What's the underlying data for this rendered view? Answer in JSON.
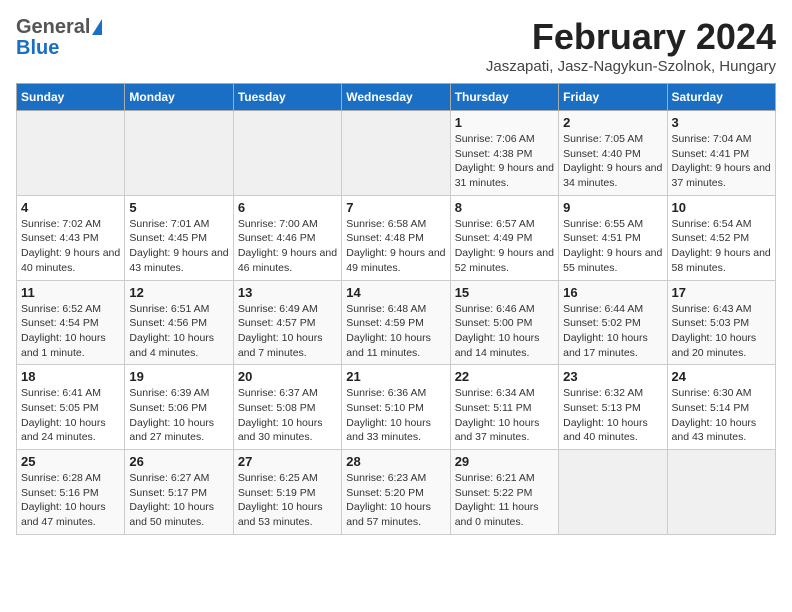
{
  "header": {
    "logo_general": "General",
    "logo_blue": "Blue",
    "month_title": "February 2024",
    "location": "Jaszapati, Jasz-Nagykun-Szolnok, Hungary"
  },
  "weekdays": [
    "Sunday",
    "Monday",
    "Tuesday",
    "Wednesday",
    "Thursday",
    "Friday",
    "Saturday"
  ],
  "weeks": [
    [
      {
        "day": "",
        "info": ""
      },
      {
        "day": "",
        "info": ""
      },
      {
        "day": "",
        "info": ""
      },
      {
        "day": "",
        "info": ""
      },
      {
        "day": "1",
        "info": "Sunrise: 7:06 AM\nSunset: 4:38 PM\nDaylight: 9 hours and 31 minutes."
      },
      {
        "day": "2",
        "info": "Sunrise: 7:05 AM\nSunset: 4:40 PM\nDaylight: 9 hours and 34 minutes."
      },
      {
        "day": "3",
        "info": "Sunrise: 7:04 AM\nSunset: 4:41 PM\nDaylight: 9 hours and 37 minutes."
      }
    ],
    [
      {
        "day": "4",
        "info": "Sunrise: 7:02 AM\nSunset: 4:43 PM\nDaylight: 9 hours and 40 minutes."
      },
      {
        "day": "5",
        "info": "Sunrise: 7:01 AM\nSunset: 4:45 PM\nDaylight: 9 hours and 43 minutes."
      },
      {
        "day": "6",
        "info": "Sunrise: 7:00 AM\nSunset: 4:46 PM\nDaylight: 9 hours and 46 minutes."
      },
      {
        "day": "7",
        "info": "Sunrise: 6:58 AM\nSunset: 4:48 PM\nDaylight: 9 hours and 49 minutes."
      },
      {
        "day": "8",
        "info": "Sunrise: 6:57 AM\nSunset: 4:49 PM\nDaylight: 9 hours and 52 minutes."
      },
      {
        "day": "9",
        "info": "Sunrise: 6:55 AM\nSunset: 4:51 PM\nDaylight: 9 hours and 55 minutes."
      },
      {
        "day": "10",
        "info": "Sunrise: 6:54 AM\nSunset: 4:52 PM\nDaylight: 9 hours and 58 minutes."
      }
    ],
    [
      {
        "day": "11",
        "info": "Sunrise: 6:52 AM\nSunset: 4:54 PM\nDaylight: 10 hours and 1 minute."
      },
      {
        "day": "12",
        "info": "Sunrise: 6:51 AM\nSunset: 4:56 PM\nDaylight: 10 hours and 4 minutes."
      },
      {
        "day": "13",
        "info": "Sunrise: 6:49 AM\nSunset: 4:57 PM\nDaylight: 10 hours and 7 minutes."
      },
      {
        "day": "14",
        "info": "Sunrise: 6:48 AM\nSunset: 4:59 PM\nDaylight: 10 hours and 11 minutes."
      },
      {
        "day": "15",
        "info": "Sunrise: 6:46 AM\nSunset: 5:00 PM\nDaylight: 10 hours and 14 minutes."
      },
      {
        "day": "16",
        "info": "Sunrise: 6:44 AM\nSunset: 5:02 PM\nDaylight: 10 hours and 17 minutes."
      },
      {
        "day": "17",
        "info": "Sunrise: 6:43 AM\nSunset: 5:03 PM\nDaylight: 10 hours and 20 minutes."
      }
    ],
    [
      {
        "day": "18",
        "info": "Sunrise: 6:41 AM\nSunset: 5:05 PM\nDaylight: 10 hours and 24 minutes."
      },
      {
        "day": "19",
        "info": "Sunrise: 6:39 AM\nSunset: 5:06 PM\nDaylight: 10 hours and 27 minutes."
      },
      {
        "day": "20",
        "info": "Sunrise: 6:37 AM\nSunset: 5:08 PM\nDaylight: 10 hours and 30 minutes."
      },
      {
        "day": "21",
        "info": "Sunrise: 6:36 AM\nSunset: 5:10 PM\nDaylight: 10 hours and 33 minutes."
      },
      {
        "day": "22",
        "info": "Sunrise: 6:34 AM\nSunset: 5:11 PM\nDaylight: 10 hours and 37 minutes."
      },
      {
        "day": "23",
        "info": "Sunrise: 6:32 AM\nSunset: 5:13 PM\nDaylight: 10 hours and 40 minutes."
      },
      {
        "day": "24",
        "info": "Sunrise: 6:30 AM\nSunset: 5:14 PM\nDaylight: 10 hours and 43 minutes."
      }
    ],
    [
      {
        "day": "25",
        "info": "Sunrise: 6:28 AM\nSunset: 5:16 PM\nDaylight: 10 hours and 47 minutes."
      },
      {
        "day": "26",
        "info": "Sunrise: 6:27 AM\nSunset: 5:17 PM\nDaylight: 10 hours and 50 minutes."
      },
      {
        "day": "27",
        "info": "Sunrise: 6:25 AM\nSunset: 5:19 PM\nDaylight: 10 hours and 53 minutes."
      },
      {
        "day": "28",
        "info": "Sunrise: 6:23 AM\nSunset: 5:20 PM\nDaylight: 10 hours and 57 minutes."
      },
      {
        "day": "29",
        "info": "Sunrise: 6:21 AM\nSunset: 5:22 PM\nDaylight: 11 hours and 0 minutes."
      },
      {
        "day": "",
        "info": ""
      },
      {
        "day": "",
        "info": ""
      }
    ]
  ]
}
